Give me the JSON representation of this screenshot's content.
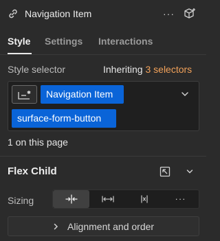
{
  "header": {
    "title": "Navigation Item",
    "more_label": "···"
  },
  "tabs": [
    {
      "label": "Style",
      "active": true
    },
    {
      "label": "Settings",
      "active": false
    },
    {
      "label": "Interactions",
      "active": false
    }
  ],
  "style_selector": {
    "label": "Style selector",
    "inheriting_prefix": "Inheriting",
    "inheriting_count": "3 selectors",
    "chips": [
      "Navigation Item",
      "surface-form-button"
    ],
    "on_page": "1 on this page"
  },
  "flex_child": {
    "title": "Flex Child",
    "sizing_label": "Sizing",
    "sizing_options": [
      "shrink-icon",
      "grow-icon",
      "none-icon",
      "more-icon"
    ],
    "more_label": "···"
  },
  "alignment": {
    "label": "Alignment and order"
  },
  "colors": {
    "background": "#2b2b2b",
    "accent_chip": "#0a64d8",
    "inheriting_count": "#f2a25a"
  }
}
